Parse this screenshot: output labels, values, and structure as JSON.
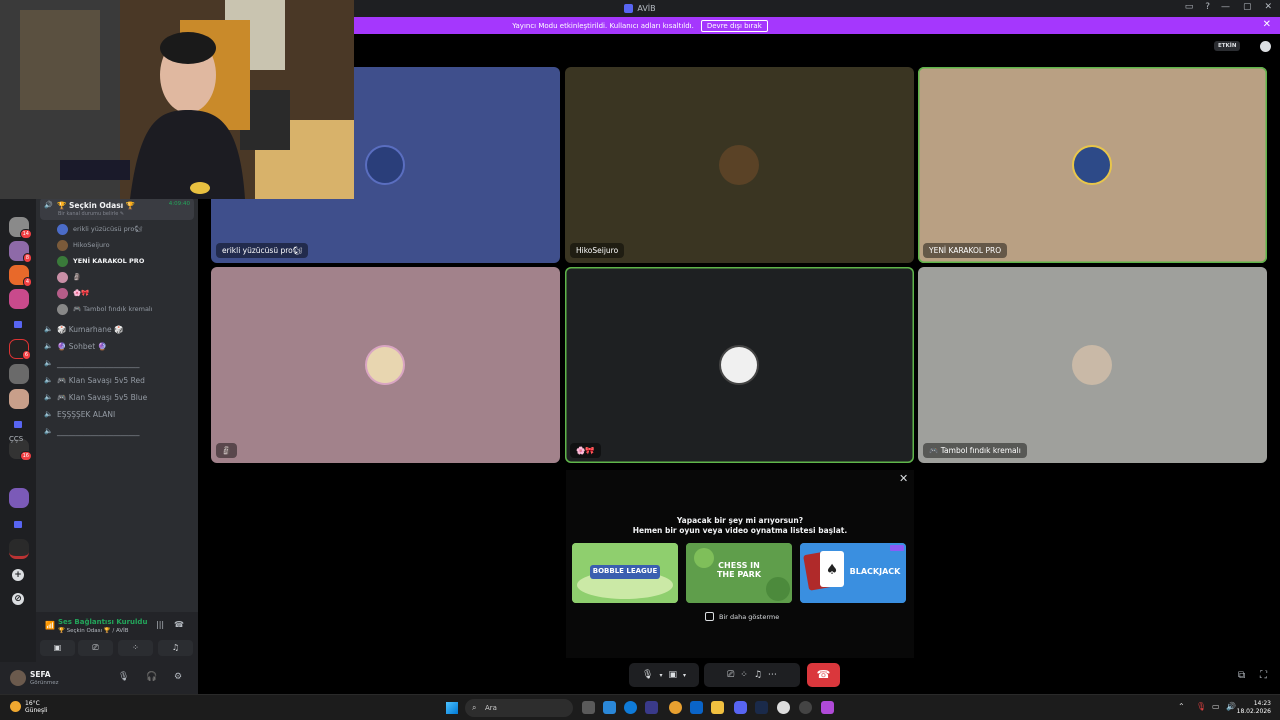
{
  "window": {
    "title": "AVİB"
  },
  "notice": {
    "text": "Yayıncı Modu etkinleştirildi. Kullanıcı adları kısaltıldı.",
    "button": "Devre dışı bırak"
  },
  "header": {
    "activity_label": "ETKİN"
  },
  "rail": {
    "label": "ÇÇS",
    "badges": [
      "14",
      "8",
      "4",
      "6",
      "16"
    ]
  },
  "channels": {
    "active_channel": "🏆 Seçkin Odası 🏆",
    "active_timer": "4:09:40",
    "active_status": "Bir kanal durumu belirle ✎",
    "users": [
      {
        "name": "erikli yüzücüsü pro🐿",
        "color": "#4b6cc8"
      },
      {
        "name": "HikoSeijuro",
        "color": "#7a5a3a"
      },
      {
        "name": "YENİ KARAKOL PRO",
        "color": "#3a7a3a"
      },
      {
        "name": "🗿",
        "color": "#c98fa6"
      },
      {
        "name": "🌸🎀",
        "color": "#b65d89"
      },
      {
        "name": "🎮 Tambol fındık kremalı",
        "color": "#888888"
      }
    ],
    "list": [
      {
        "label": "🎲 Kumarhane 🎲"
      },
      {
        "label": "🔮 Sohbet 🔮"
      },
      {
        "label": "______________________"
      },
      {
        "label": "🎮 Klan Savaşı 5v5 Red"
      },
      {
        "label": "🎮 Klan Savaşı 5v5 Blue"
      },
      {
        "label": "EŞŞŞŞEK ALANI"
      },
      {
        "label": "______________________"
      }
    ]
  },
  "voice": {
    "status": "Ses Bağlantısı Kuruldu",
    "channel": "🏆 Seçkin Odası 🏆 / AVİB"
  },
  "user": {
    "name": "SEFA",
    "status": "Görünmez"
  },
  "tiles": [
    {
      "name": "erikli yüzücüsü pro🐿",
      "bg": "#3f4f8c",
      "avatar": "#2a3e7a"
    },
    {
      "name": "HikoSeijuro",
      "bg": "#3a3522",
      "avatar": "#5a4226"
    },
    {
      "name": "YENİ KARAKOL PRO",
      "bg": "#b9a083",
      "avatar": "#2d4a88"
    },
    {
      "name": "🗿",
      "bg": "#a2828b",
      "avatar": "#e8d6b0"
    },
    {
      "name": "🌸🎀",
      "bg": "#1e2022",
      "avatar": "#f0f0f0"
    },
    {
      "name": "🎮 Tambol fındık kremalı",
      "bg": "#9fa09c",
      "avatar": "#c9b9a7"
    }
  ],
  "activity": {
    "line1": "Yapacak bir şey mi arıyorsun?",
    "line2": "Hemen bir oyun veya video oynatma listesi başlat.",
    "games": [
      {
        "title": "BOBBLE LEAGUE",
        "bg": "#8fcf6e"
      },
      {
        "title": "CHESS IN THE PARK",
        "bg": "#5f9e4b"
      },
      {
        "title": "BLACKJACK",
        "bg": "#3a8fe0"
      }
    ],
    "dont_show": "Bir daha gösterme"
  },
  "taskbar": {
    "weather_temp": "16°C",
    "weather_desc": "Güneşli",
    "search_placeholder": "Ara",
    "time": "14:23",
    "date": "18.02.2026"
  }
}
